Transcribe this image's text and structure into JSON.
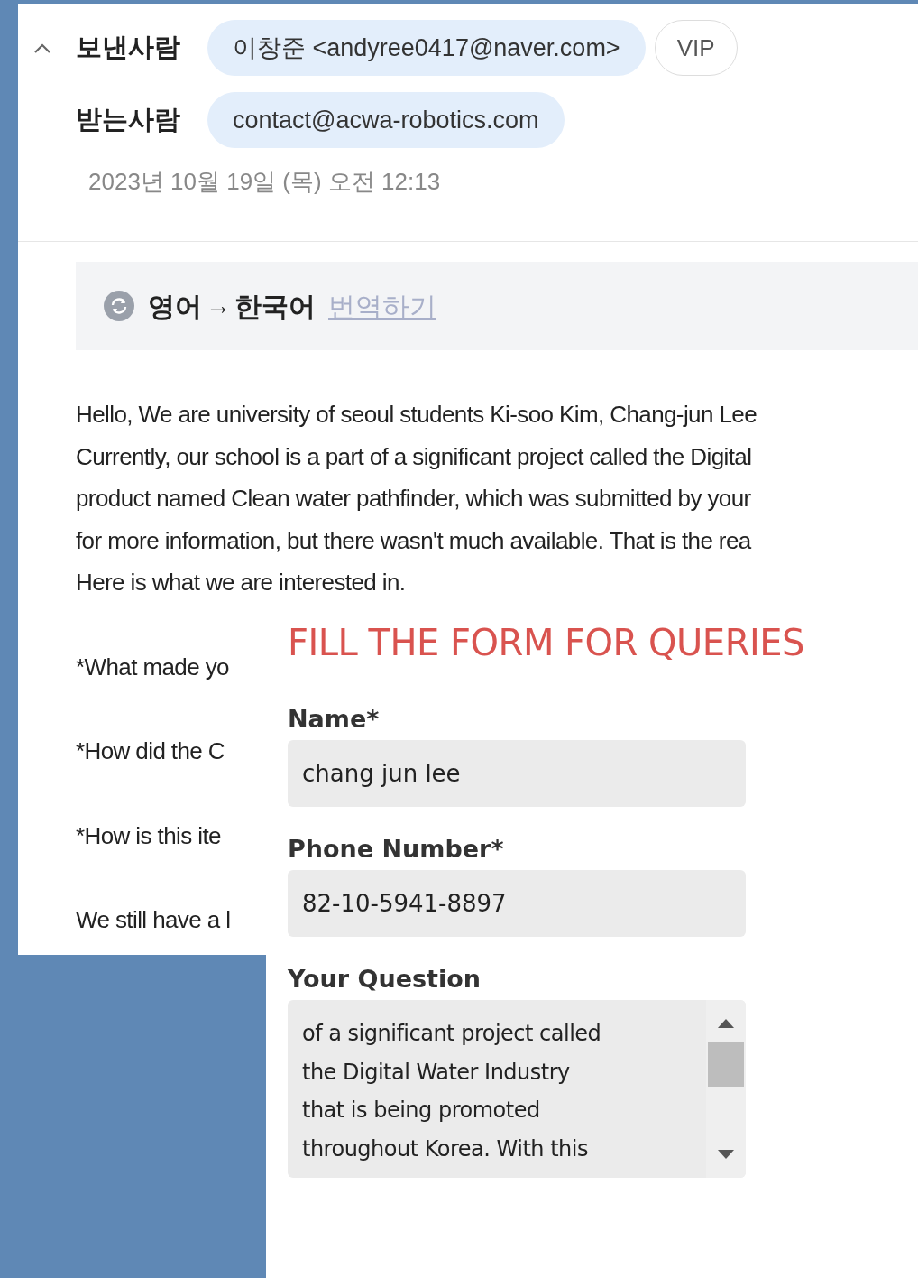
{
  "email": {
    "sender": {
      "label": "보낸사람",
      "value": "이창준 <andyree0417@naver.com>",
      "badge": "VIP"
    },
    "recipient": {
      "label": "받는사람",
      "value": "contact@acwa-robotics.com"
    },
    "date": "2023년 10월 19일 (목) 오전 12:13",
    "translation": {
      "source": "영어",
      "separator": "→",
      "target": "한국어",
      "action": "번역하기"
    },
    "paragraphs": [
      [
        "Hello, We are university of seoul students Ki-soo Kim, Chang-jun Lee",
        "Currently, our school is a part of a significant project called the Digital",
        "product named Clean water pathfinder, which was submitted by your",
        "for more information, but there wasn't much available. That is the rea",
        "Here is what we are interested in."
      ],
      [
        "*What made yo"
      ],
      [
        "*How did the C"
      ],
      [
        "*How is this ite"
      ],
      [
        "We still have a l"
      ]
    ]
  },
  "form": {
    "title": "FILL THE FORM FOR QUERIES",
    "fields": [
      {
        "kind": "input",
        "label": "Name*",
        "value": "chang jun lee"
      },
      {
        "kind": "input",
        "label": "Phone Number*",
        "value": "82-10-5941-8897"
      },
      {
        "kind": "textarea",
        "label": "Your Question",
        "lines": [
          "of a significant project called",
          "the Digital Water Industry",
          "that is being promoted",
          "throughout Korea. With this"
        ]
      }
    ]
  }
}
